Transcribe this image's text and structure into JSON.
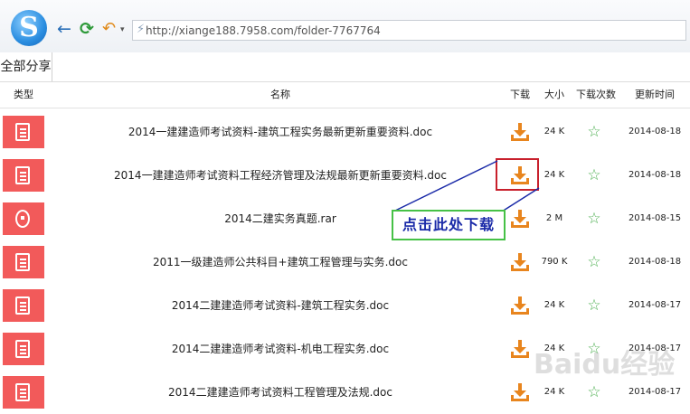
{
  "browser": {
    "url": "http://xiange188.7958.com/folder-7767764"
  },
  "tab": {
    "label": "全部分享"
  },
  "columns": {
    "type": "类型",
    "name": "名称",
    "download": "下载",
    "size": "大小",
    "downloads": "下载次数",
    "updated": "更新时间"
  },
  "files": [
    {
      "name": "2014一建建造师考试资料-建筑工程实务最新更新重要资料.doc",
      "size": "24 K",
      "date": "2014-08-18",
      "kind": "doc"
    },
    {
      "name": "2014一建建造师考试资料工程经济管理及法规最新更新重要资料.doc",
      "size": "24 K",
      "date": "2014-08-18",
      "kind": "doc"
    },
    {
      "name": "2014二建实务真题.rar",
      "size": "2 M",
      "date": "2014-08-15",
      "kind": "rar"
    },
    {
      "name": "2011一级建造师公共科目+建筑工程管理与实务.doc",
      "size": "790 K",
      "date": "2014-08-18",
      "kind": "doc"
    },
    {
      "name": "2014二建建造师考试资料-建筑工程实务.doc",
      "size": "24 K",
      "date": "2014-08-17",
      "kind": "doc"
    },
    {
      "name": "2014二建建造师考试资料-机电工程实务.doc",
      "size": "24 K",
      "date": "2014-08-17",
      "kind": "doc"
    },
    {
      "name": "2014二建建造师考试资料工程管理及法规.doc",
      "size": "24 K",
      "date": "2014-08-17",
      "kind": "doc"
    }
  ],
  "annotation": {
    "label": "点击此处下载"
  },
  "watermark": {
    "text": "Baidu经验"
  },
  "colors": {
    "file_icon": "#f25a5a",
    "download_icon": "#e8851e",
    "star": "#4caf50",
    "highlight": "#c8202c",
    "callout_border": "#46c146"
  }
}
